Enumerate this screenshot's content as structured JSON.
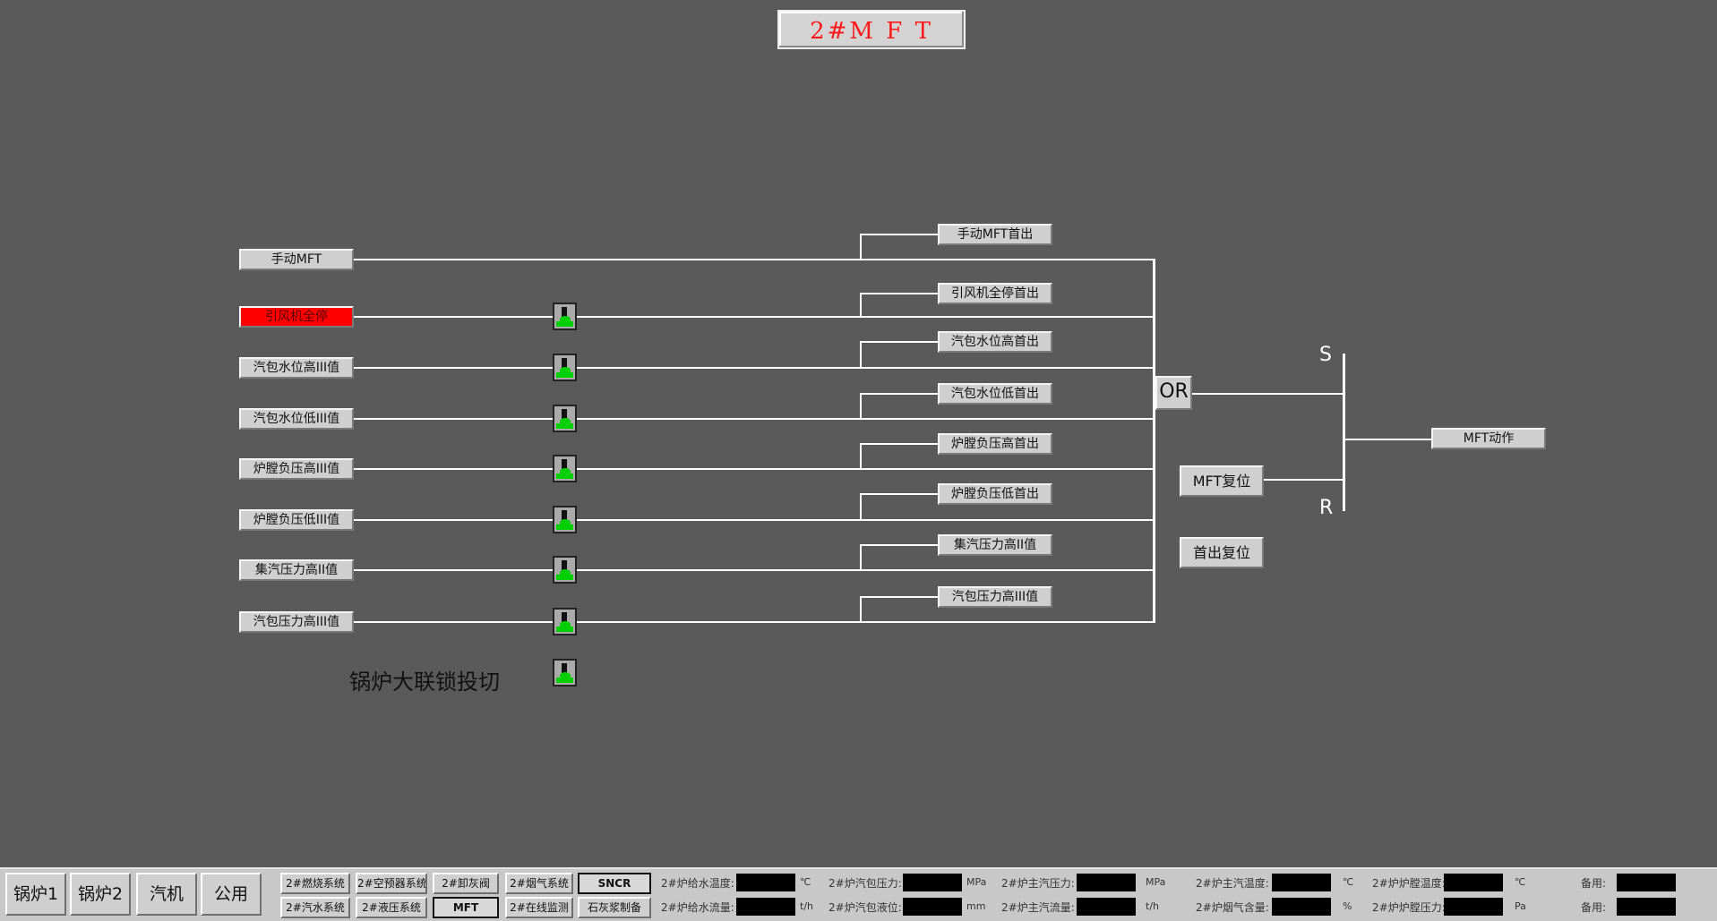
{
  "title": "2#M F T",
  "inputs": [
    {
      "label": "手动MFT",
      "alarm": false
    },
    {
      "label": "引风机全停",
      "alarm": true
    },
    {
      "label": "汽包水位高III值",
      "alarm": false
    },
    {
      "label": "汽包水位低III值",
      "alarm": false
    },
    {
      "label": "炉膛负压高III值",
      "alarm": false
    },
    {
      "label": "炉膛负压低III值",
      "alarm": false
    },
    {
      "label": "集汽压力高II值",
      "alarm": false
    },
    {
      "label": "汽包压力高III值",
      "alarm": false
    }
  ],
  "first_outs": [
    "手动MFT首出",
    "引风机全停首出",
    "汽包水位高首出",
    "汽包水位低首出",
    "炉膛负压高首出",
    "炉膛负压低首出",
    "集汽压力高II值",
    "汽包压力高III值"
  ],
  "interlock_label": "锅炉大联锁投切",
  "or_label": "OR",
  "set_label": "S",
  "reset_label": "R",
  "mft_action": "MFT动作",
  "mft_reset": "MFT复位",
  "firstout_reset": "首出复位",
  "nav": {
    "main": [
      "锅炉1",
      "锅炉2",
      "汽机",
      "公用"
    ],
    "top_row": [
      "2#燃烧系统",
      "2#空预器系统",
      "2#卸灰阀",
      "2#烟气系统",
      "SNCR"
    ],
    "bottom_row": [
      "2#汽水系统",
      "2#液压系统",
      "MFT",
      "2#在线监测",
      "石灰浆制备"
    ]
  },
  "status": {
    "row1": [
      {
        "label": "2#炉给水温度:",
        "unit": "℃"
      },
      {
        "label": "2#炉汽包压力:",
        "unit": "MPa"
      },
      {
        "label": "2#炉主汽压力:",
        "unit": "MPa"
      },
      {
        "label": "2#炉主汽温度:",
        "unit": "℃"
      },
      {
        "label": "2#炉炉膛温度:",
        "unit": "℃"
      },
      {
        "label": "备用:",
        "unit": ""
      }
    ],
    "row2": [
      {
        "label": "2#炉给水流量:",
        "unit": "t/h"
      },
      {
        "label": "2#炉汽包液位:",
        "unit": "mm"
      },
      {
        "label": "2#炉主汽流量:",
        "unit": "t/h"
      },
      {
        "label": "2#炉烟气含量:",
        "unit": "%"
      },
      {
        "label": "2#炉炉膛压力:",
        "unit": "Pa"
      },
      {
        "label": "备用:",
        "unit": ""
      }
    ]
  }
}
